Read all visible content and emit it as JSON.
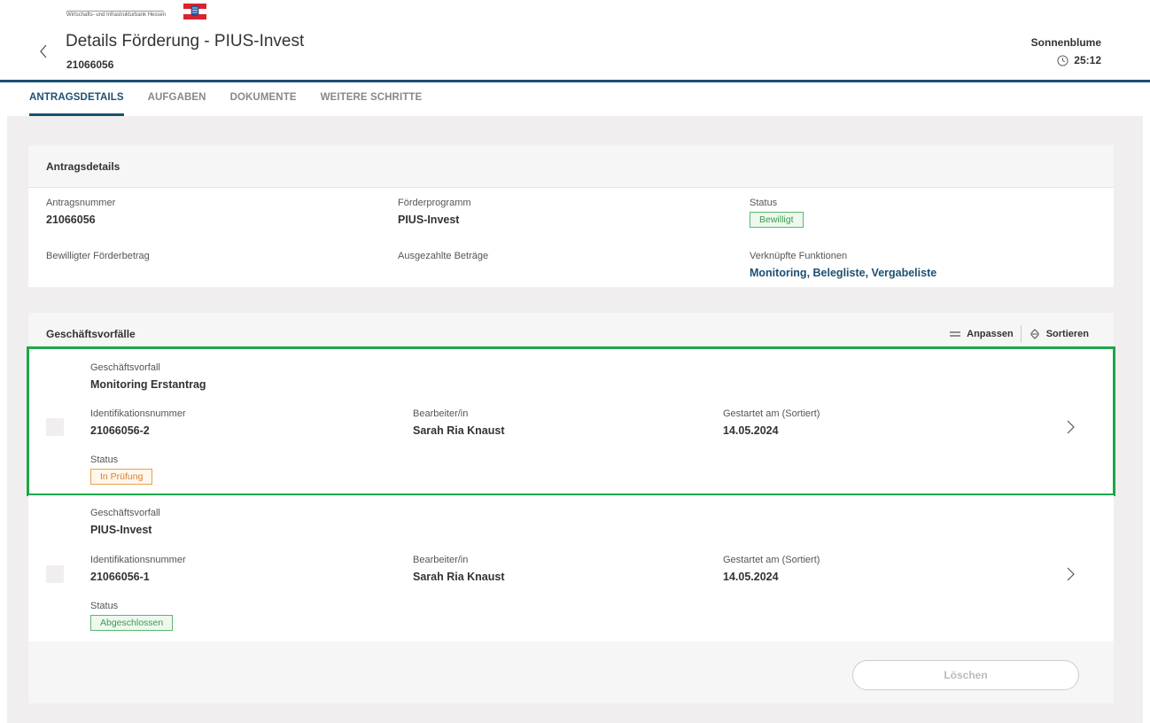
{
  "header": {
    "logo_text": "Wirtschafts- und Infrastrukturbank Hessen",
    "title": "Details Förderung - PIUS-Invest",
    "subtitle": "21066056",
    "user": "Sonnenblume",
    "timer": "25:12"
  },
  "tabs": [
    {
      "label": "ANTRAGSDETAILS",
      "active": true
    },
    {
      "label": "AUFGABEN"
    },
    {
      "label": "DOKUMENTE"
    },
    {
      "label": "WEITERE SCHRITTE"
    }
  ],
  "antragsdetails": {
    "title": "Antragsdetails",
    "antragsnummer_label": "Antragsnummer",
    "antragsnummer": "21066056",
    "foerderprogramm_label": "Förderprogramm",
    "foerderprogramm": "PIUS-Invest",
    "status_label": "Status",
    "status": "Bewilligt",
    "betrag_label": "Bewilligter Förderbetrag",
    "ausgezahlt_label": "Ausgezahlte Beträge",
    "funktionen_label": "Verknüpfte Funktionen",
    "funktionen": [
      "Monitoring",
      "Belegliste",
      "Vergabeliste"
    ]
  },
  "geschaeftsvorfaelle": {
    "title": "Geschäftsvorfälle",
    "anpassen": "Anpassen",
    "sortieren": "Sortieren",
    "rows": [
      {
        "vorfall_label": "Geschäftsvorfall",
        "vorfall": "Monitoring Erstantrag",
        "id_label": "Identifikationsnummer",
        "id": "21066056-2",
        "bearbeiter_label": "Bearbeiter/in",
        "bearbeiter": "Sarah Ria Knaust",
        "gestartet_label": "Gestartet am (Sortiert)",
        "gestartet": "14.05.2024",
        "status_label": "Status",
        "status": "In Prüfung"
      },
      {
        "vorfall_label": "Geschäftsvorfall",
        "vorfall": "PIUS-Invest",
        "id_label": "Identifikationsnummer",
        "id": "21066056-1",
        "bearbeiter_label": "Bearbeiter/in",
        "bearbeiter": "Sarah Ria Knaust",
        "gestartet_label": "Gestartet am (Sortiert)",
        "gestartet": "14.05.2024",
        "status_label": "Status",
        "status": "Abgeschlossen"
      }
    ],
    "delete_label": "Löschen"
  },
  "colors": {
    "brand": "#1d4f73",
    "highlight": "#1aa74a",
    "status_green": "#3d9a4d",
    "status_orange": "#d9822b"
  }
}
